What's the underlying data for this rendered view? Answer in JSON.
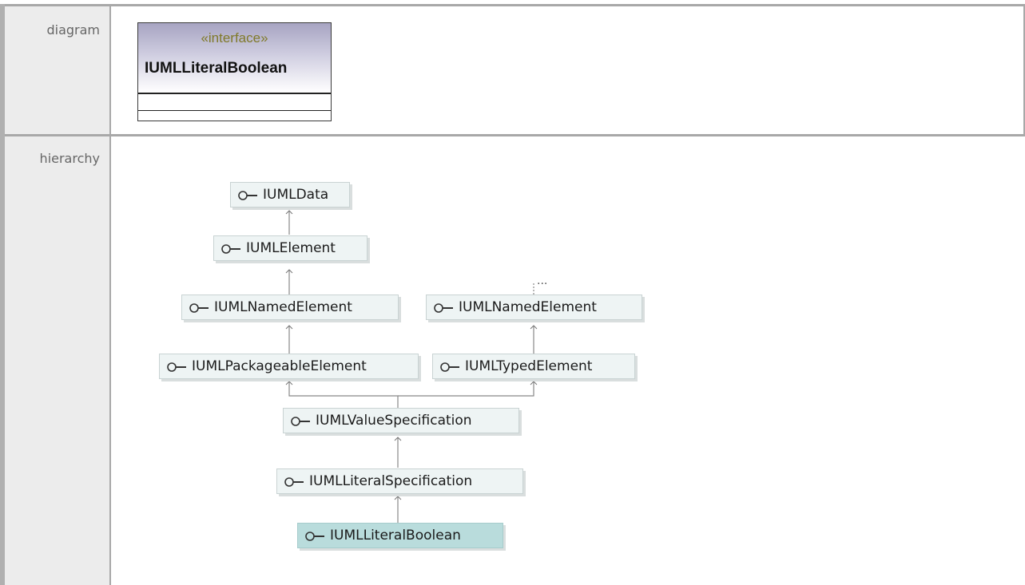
{
  "rows": {
    "diagram_label": "diagram",
    "hierarchy_label": "hierarchy"
  },
  "uml_class": {
    "stereotype": "«interface»",
    "name": "IUMLLiteralBoolean"
  },
  "hierarchy": {
    "ellipsis": "...",
    "nodes": [
      {
        "key": "n1",
        "label": "IUMLData"
      },
      {
        "key": "n2",
        "label": "IUMLElement"
      },
      {
        "key": "n3",
        "label": "IUMLNamedElement"
      },
      {
        "key": "n4",
        "label": "IUMLNamedElement"
      },
      {
        "key": "n5",
        "label": "IUMLPackageableElement"
      },
      {
        "key": "n6",
        "label": "IUMLTypedElement"
      },
      {
        "key": "n7",
        "label": "IUMLValueSpecification"
      },
      {
        "key": "n8",
        "label": "IUMLLiteralSpecification"
      },
      {
        "key": "n9",
        "label": "IUMLLiteralBoolean",
        "current": true
      }
    ]
  },
  "colors": {
    "label_background": "#ececec",
    "border": "#a8a8a8",
    "node_fill": "#eef4f4",
    "current_node_fill": "#b9dcdc",
    "stereotype": "#807a2a"
  }
}
